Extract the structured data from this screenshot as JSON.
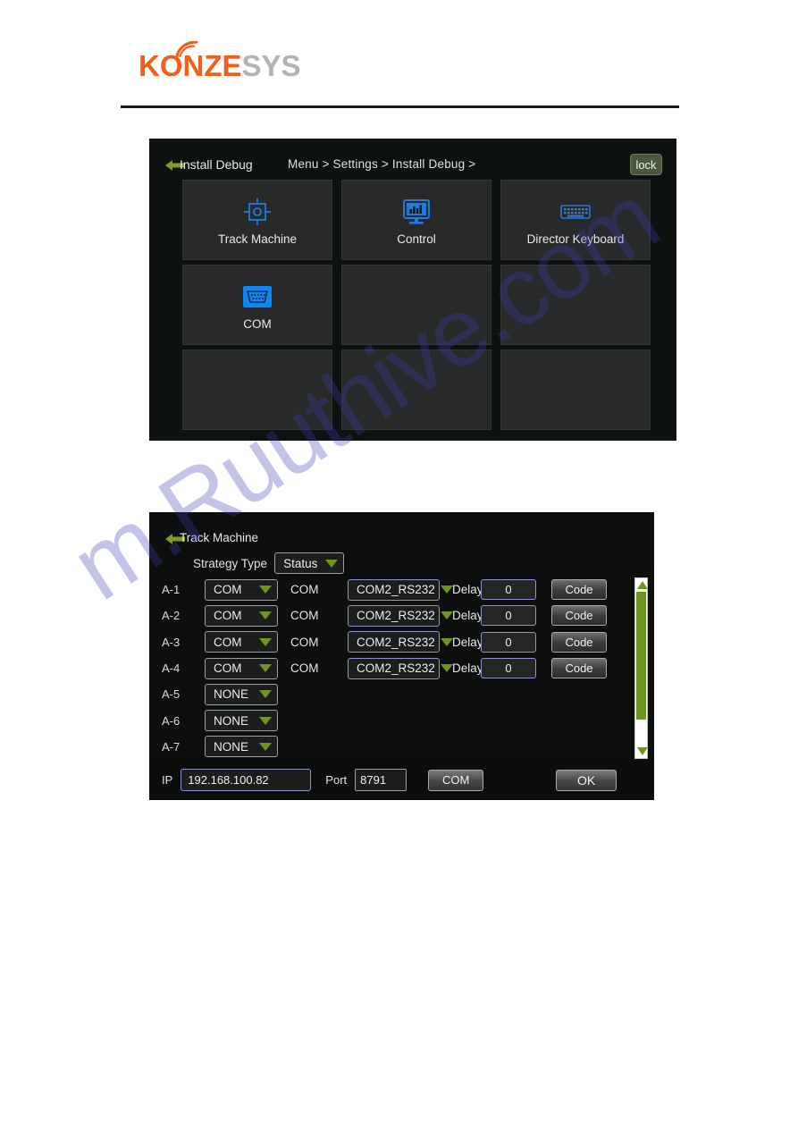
{
  "brand": {
    "name_primary": "KONZE",
    "name_secondary": "SYS",
    "primary_color": "#f0601c",
    "secondary_color": "#b3b3b3",
    "arc_icon": "wifi-arc-icon"
  },
  "watermark": {
    "line1": "m.Ruuthive.com"
  },
  "install_debug": {
    "back_icon": "back-arrow-icon",
    "title": "Install Debug",
    "breadcrumb": "Menu >  Settings >  Install Debug >",
    "lock_label": "lock",
    "accent_color": "#1e90ff",
    "tiles": [
      {
        "label": "Track Machine",
        "icon": "target-crosshair-icon",
        "empty": false
      },
      {
        "label": "Control",
        "icon": "monitor-chart-icon",
        "empty": false
      },
      {
        "label": "Director Keyboard",
        "icon": "keyboard-icon",
        "empty": false
      },
      {
        "label": "COM",
        "icon": "serial-port-icon",
        "empty": false
      },
      {
        "label": "",
        "icon": "",
        "empty": true
      },
      {
        "label": "",
        "icon": "",
        "empty": true
      },
      {
        "label": "",
        "icon": "",
        "empty": true
      },
      {
        "label": "",
        "icon": "",
        "empty": true
      },
      {
        "label": "",
        "icon": "",
        "empty": true
      }
    ]
  },
  "track_machine": {
    "back_icon": "back-arrow-icon",
    "title": "Track Machine",
    "strategy_type_label": "Strategy Type",
    "strategy_type_value": "Status",
    "rows": [
      {
        "id": "A-1",
        "mode": "COM",
        "mid_text": "COM",
        "port": "COM2_RS232",
        "delay_label": "Delay",
        "delay_value": "0",
        "code_label": "Code",
        "extended": true
      },
      {
        "id": "A-2",
        "mode": "COM",
        "mid_text": "COM",
        "port": "COM2_RS232",
        "delay_label": "Delay",
        "delay_value": "0",
        "code_label": "Code",
        "extended": true
      },
      {
        "id": "A-3",
        "mode": "COM",
        "mid_text": "COM",
        "port": "COM2_RS232",
        "delay_label": "Delay",
        "delay_value": "0",
        "code_label": "Code",
        "extended": true
      },
      {
        "id": "A-4",
        "mode": "COM",
        "mid_text": "COM",
        "port": "COM2_RS232",
        "delay_label": "Delay",
        "delay_value": "0",
        "code_label": "Code",
        "extended": true
      },
      {
        "id": "A-5",
        "mode": "NONE",
        "mid_text": "",
        "port": "",
        "delay_label": "",
        "delay_value": "",
        "code_label": "",
        "extended": false
      },
      {
        "id": "A-6",
        "mode": "NONE",
        "mid_text": "",
        "port": "",
        "delay_label": "",
        "delay_value": "",
        "code_label": "",
        "extended": false
      },
      {
        "id": "A-7",
        "mode": "NONE",
        "mid_text": "",
        "port": "",
        "delay_label": "",
        "delay_value": "",
        "code_label": "",
        "extended": false
      }
    ],
    "scrollbar": {
      "up_icon": "scroll-up-arrow-icon",
      "down_icon": "scroll-down-arrow-icon",
      "thumb_color": "#6e9421"
    },
    "footer": {
      "ip_label": "IP",
      "ip_value": "192.168.100.82",
      "port_label": "Port",
      "port_value": "8791",
      "com_label": "COM",
      "ok_label": "OK"
    }
  }
}
